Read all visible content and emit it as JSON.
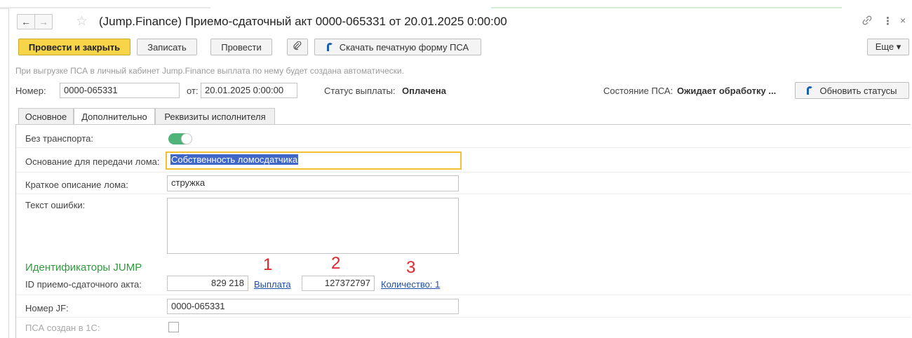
{
  "window": {
    "title": "(Jump.Finance) Приемо-сдаточный акт 0000-065331 от 20.01.2025 0:00:00",
    "icons": [
      "back-arrow-icon",
      "forward-arrow-icon",
      "favorite-star-icon",
      "link-icon",
      "more-vertical-icon",
      "close-icon"
    ]
  },
  "toolbar": {
    "post_close_label": "Провести и закрыть",
    "save_label": "Записать",
    "post_label": "Провести",
    "download_label": "Скачать печатную форму ПСА",
    "more_label": "Еще ▾",
    "colors": {
      "primary": "#f7d448",
      "accent_icon": "#1a5fb4"
    }
  },
  "info_text": "При выгрузке ПСА в личный кабинет Jump.Finance выплата по нему будет создана автоматически.",
  "header": {
    "number_label": "Номер:",
    "number_value": "0000-065331",
    "date_label": "от:",
    "date_value": "20.01.2025  0:00:00",
    "payment_status_label": "Статус выплаты:",
    "payment_status_value": "Оплачена",
    "psa_state_label": "Состояние ПСА:",
    "psa_state_value": "Ожидает обработку ...",
    "refresh_label": "Обновить статусы"
  },
  "tabs": [
    {
      "label": "Основное",
      "active": false
    },
    {
      "label": "Дополнительно",
      "active": true
    },
    {
      "label": "Реквизиты исполнителя",
      "active": false
    }
  ],
  "form": {
    "no_transport_label": "Без транспорта:",
    "no_transport_on": true,
    "basis_label": "Основание для передачи лома:",
    "basis_value": "Собственность ломосдатчика",
    "description_label": "Краткое описание лома:",
    "description_value": "стружка",
    "error_label": "Текст ошибки:",
    "error_value": "",
    "section_title": "Идентификаторы JUMP",
    "act_id_label": "ID приемо-сдаточного акта:",
    "act_id_value": "829 218",
    "payment_link": "Выплата",
    "payment_id_value": "127372797",
    "quantity_link": "Количество: 1",
    "jf_number_label": "Номер JF:",
    "jf_number_value": "0000-065331",
    "created_in_1c_label": "ПСА создан в 1С:",
    "created_in_1c_checked": false,
    "colors": {
      "section": "#2d9a3c",
      "toggle": "#4fb37a",
      "selection": "#3f67c9",
      "link": "#1f4fa8"
    }
  },
  "annotations": [
    {
      "text": "1",
      "color": "#e0262a"
    },
    {
      "text": "2",
      "color": "#e0262a"
    },
    {
      "text": "3",
      "color": "#e0262a"
    }
  ]
}
